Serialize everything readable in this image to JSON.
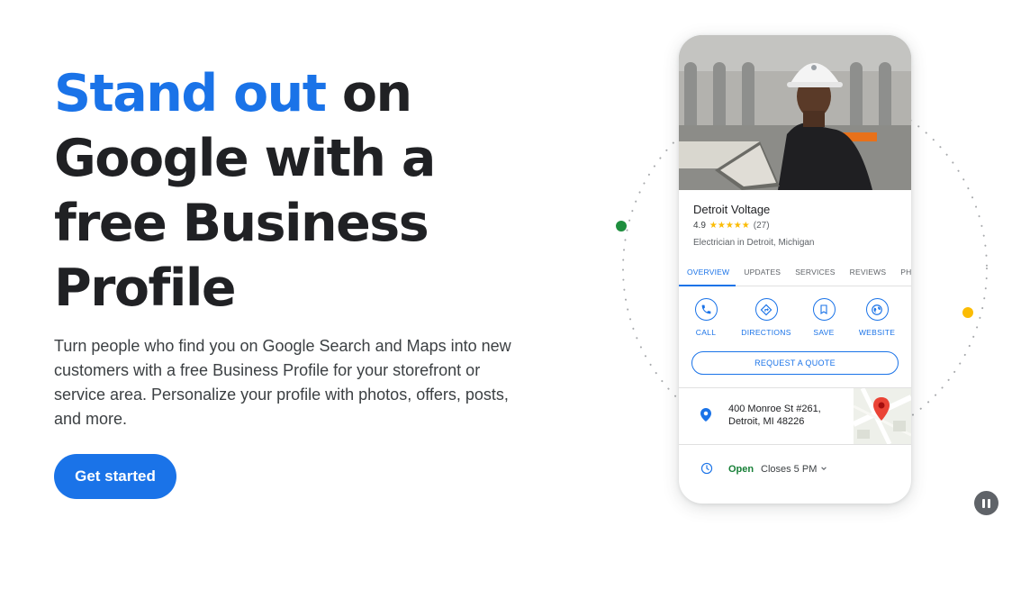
{
  "hero": {
    "heading_accent": "Stand out",
    "heading_rest": " on Google with a free Business Profile",
    "description": "Turn people who find you on Google Search and Maps into new customers with a free Business Profile for your storefront or service area. Personalize your profile with photos, offers, posts, and more.",
    "cta_label": "Get started"
  },
  "profile_card": {
    "business_name": "Detroit Voltage",
    "rating": "4.9",
    "stars": "★★★★★",
    "review_count": "(27)",
    "category": "Electrician in Detroit, Michigan",
    "tabs": [
      "OVERVIEW",
      "UPDATES",
      "SERVICES",
      "REVIEWS",
      "PHO"
    ],
    "active_tab": "OVERVIEW",
    "actions": [
      {
        "label": "CALL",
        "icon": "phone-icon"
      },
      {
        "label": "DIRECTIONS",
        "icon": "directions-icon"
      },
      {
        "label": "SAVE",
        "icon": "bookmark-icon"
      },
      {
        "label": "WEBSITE",
        "icon": "globe-icon"
      }
    ],
    "quote_button": "REQUEST A QUOTE",
    "address_line1": "400 Monroe St #261,",
    "address_line2": "Detroit, MI 48226",
    "hours_status": "Open",
    "hours_detail": "Closes 5 PM"
  },
  "colors": {
    "accent_blue": "#1a73e8",
    "heading_dark": "#202124",
    "open_green": "#188038",
    "ring_dot_green": "#1e8e3e",
    "ring_dot_yellow": "#fbbc04"
  }
}
